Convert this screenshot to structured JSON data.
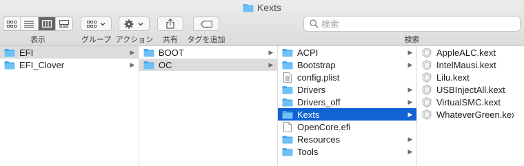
{
  "window": {
    "title": "Kexts"
  },
  "toolbar": {
    "view_label": "表示",
    "group_label": "グループ",
    "action_label": "アクション",
    "share_label": "共有",
    "tag_label": "タグを追加",
    "search_label": "検索",
    "search_placeholder": "検索"
  },
  "columns": {
    "col1": [
      {
        "label": "EFI",
        "type": "folder",
        "chevron": "▶",
        "state": "path"
      },
      {
        "label": "EFI_Clover",
        "type": "folder",
        "chevron": "▶",
        "state": ""
      }
    ],
    "col2": [
      {
        "label": "BOOT",
        "type": "folder",
        "chevron": "▶",
        "state": ""
      },
      {
        "label": "OC",
        "type": "folder",
        "chevron": "▶",
        "state": "path"
      }
    ],
    "col3": [
      {
        "label": "ACPI",
        "type": "folder",
        "chevron": "▶",
        "state": ""
      },
      {
        "label": "Bootstrap",
        "type": "folder",
        "chevron": "▶",
        "state": ""
      },
      {
        "label": "config.plist",
        "type": "plist",
        "chevron": "",
        "state": ""
      },
      {
        "label": "Drivers",
        "type": "folder",
        "chevron": "▶",
        "state": ""
      },
      {
        "label": "Drivers_off",
        "type": "folder",
        "chevron": "▶",
        "state": ""
      },
      {
        "label": "Kexts",
        "type": "folder",
        "chevron": "▶",
        "state": "selected"
      },
      {
        "label": "OpenCore.efi",
        "type": "file",
        "chevron": "",
        "state": ""
      },
      {
        "label": "Resources",
        "type": "folder",
        "chevron": "▶",
        "state": ""
      },
      {
        "label": "Tools",
        "type": "folder",
        "chevron": "▶",
        "state": ""
      }
    ],
    "col4": [
      {
        "label": "AppleALC.kext",
        "type": "kext",
        "chevron": "",
        "state": ""
      },
      {
        "label": "IntelMausi.kext",
        "type": "kext",
        "chevron": "",
        "state": ""
      },
      {
        "label": "Lilu.kext",
        "type": "kext",
        "chevron": "",
        "state": ""
      },
      {
        "label": "USBInjectAll.kext",
        "type": "kext",
        "chevron": "",
        "state": ""
      },
      {
        "label": "VirtualSMC.kext",
        "type": "kext",
        "chevron": "",
        "state": ""
      },
      {
        "label": "WhateverGreen.kext",
        "type": "kext",
        "chevron": "",
        "state": ""
      }
    ]
  },
  "colors": {
    "folder": "#5ab3f2",
    "selection": "#1163d3",
    "path_highlight": "#dcdcdc"
  }
}
